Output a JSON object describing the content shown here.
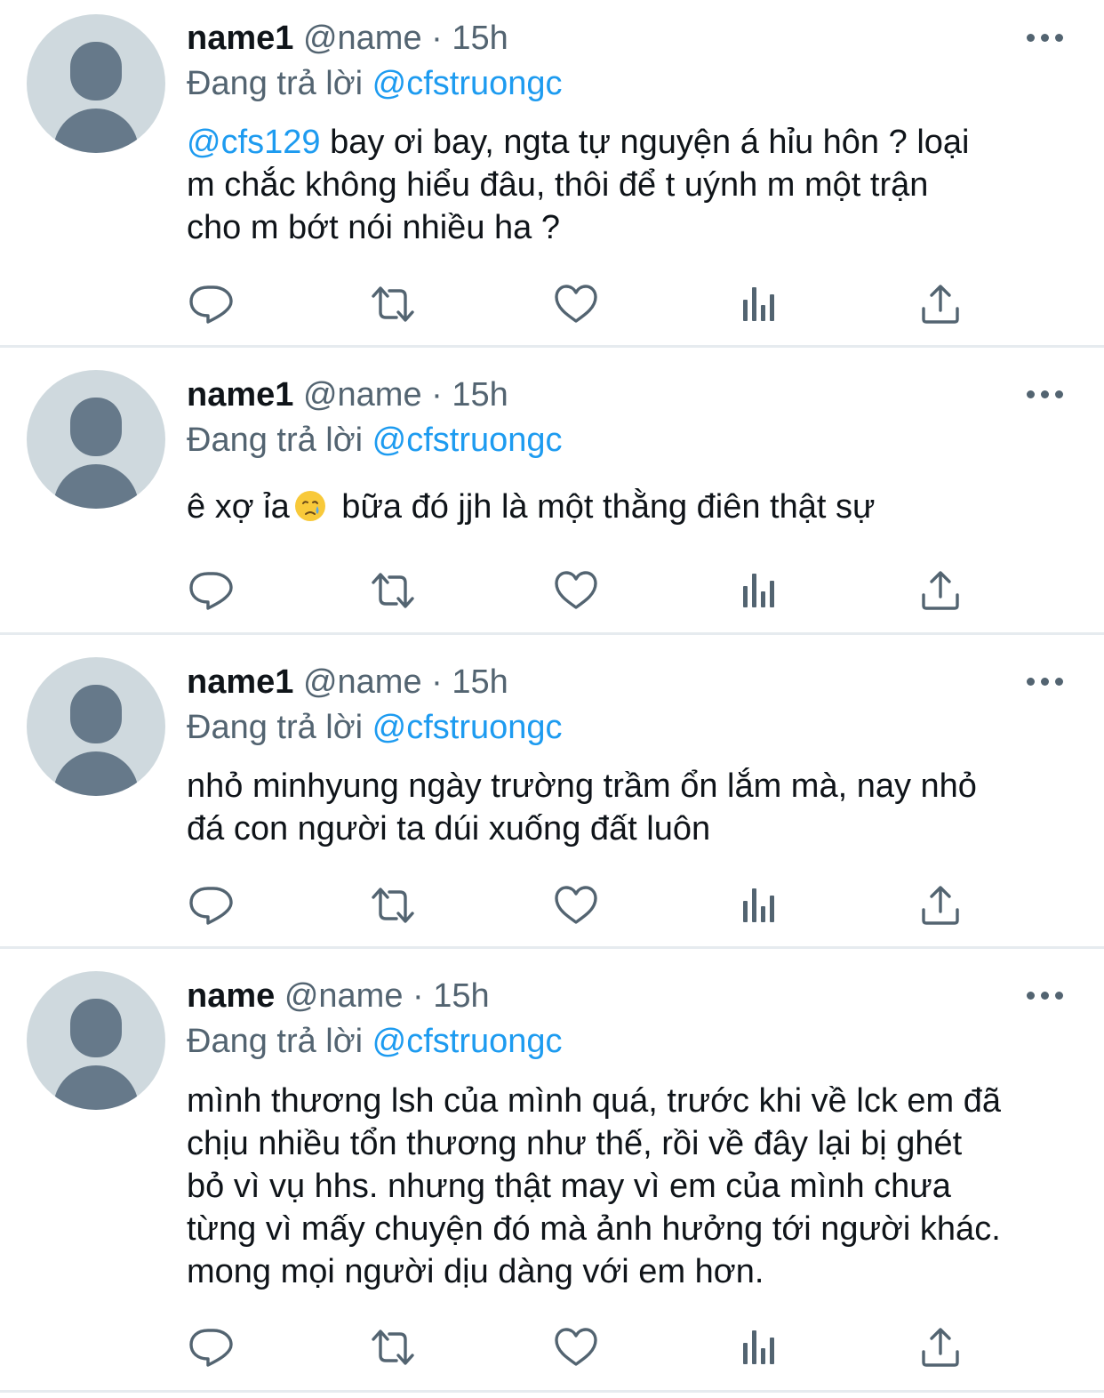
{
  "tweets": [
    {
      "display_name": "name1",
      "handle": "@name",
      "separator": " · ",
      "time": "15h",
      "replying_label": "Đang trả lời ",
      "replying_to": "@cfstruongc",
      "text_mention": "@cfs129",
      "text": " bay ơi bay, ngta tự nguyện á hỉu hôn ? loại\nm chắc không hiểu đâu, thôi để t uýnh m một trận\ncho m bớt nói nhiều ha ?"
    },
    {
      "display_name": "name1",
      "handle": "@name",
      "separator": " · ",
      "time": "15h",
      "replying_label": "Đang trả lời ",
      "replying_to": "@cfstruongc",
      "text_before_emoji": "ê xợ ỉa",
      "emoji": "crying-face",
      "text_after_emoji": " bữa đó jjh là một thằng điên thật sự"
    },
    {
      "display_name": "name1",
      "handle": "@name",
      "separator": " · ",
      "time": "15h",
      "replying_label": "Đang trả lời ",
      "replying_to": "@cfstruongc",
      "text": "nhỏ minhyung ngày trường trầm ổn lắm mà, nay nhỏ\nđá con người ta dúi xuống đất luôn"
    },
    {
      "display_name": "name",
      "handle": "@name",
      "separator": " · ",
      "time": "15h",
      "replying_label": "Đang trả lời ",
      "replying_to": "@cfstruongc",
      "text": "mình thương lsh của mình quá, trước khi về lck em đã\nchịu nhiều tổn thương như thế, rồi về đây lại bị ghét\nbỏ vì vụ hhs. nhưng thật may vì em của mình chưa\ntừng vì mấy chuyện đó mà ảnh hưởng tới người khác.\nmong mọi người dịu dàng với em hơn."
    }
  ],
  "action_icons": [
    "reply-icon",
    "retweet-icon",
    "like-icon",
    "analytics-icon",
    "share-icon"
  ],
  "colors": {
    "text": "#0f1419",
    "secondary": "#536471",
    "link": "#1d9bf0",
    "avatar_bg": "#cfd9de",
    "avatar_fg": "#66798a",
    "divider": "#e6ebef"
  }
}
